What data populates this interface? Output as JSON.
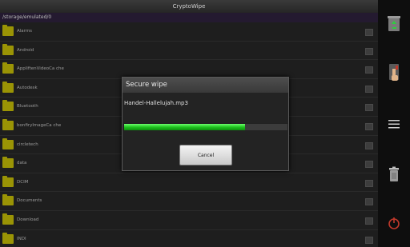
{
  "app": {
    "title": "CryptoWipe",
    "path": "/storage/emulated/0"
  },
  "folders": [
    {
      "label": "Alarms"
    },
    {
      "label": "Android"
    },
    {
      "label": "AppliftenVideoCa che"
    },
    {
      "label": "Autodesk"
    },
    {
      "label": "Bluetooth"
    },
    {
      "label": "bonfirylmageCa che"
    },
    {
      "label": "circletech"
    },
    {
      "label": "data"
    },
    {
      "label": "DCIM"
    },
    {
      "label": "Documents"
    },
    {
      "label": "Download"
    },
    {
      "label": "INDI"
    }
  ],
  "dialog": {
    "title": "Secure wipe",
    "file": "Handel-Hallelujah.mp3",
    "progress": 0.74,
    "cancel_label": "Cancel"
  },
  "sidebar": {
    "icons": [
      "recycle-bin-icon",
      "touch-hand-icon",
      "menu-icon",
      "trash-icon",
      "power-icon"
    ]
  }
}
